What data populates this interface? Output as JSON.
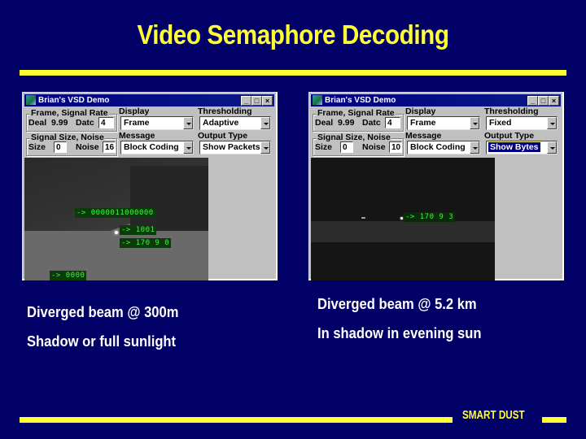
{
  "slide": {
    "title": "Video Semaphore Decoding",
    "footer_brand": "SMART DUST",
    "colors": {
      "background": "#000066",
      "accent": "#ffff33",
      "caption": "#ffffff",
      "overlay_text": "#33ff33"
    }
  },
  "windows": [
    {
      "title": "Brian's VSD Demo",
      "controls": {
        "minimize": "_",
        "maximize": "□",
        "close": "×"
      },
      "frame_group": {
        "label": "Frame, Signal Rate",
        "rate_label": "Deal",
        "rate_value": "9.99",
        "data_label": "Datc",
        "data_value": "4"
      },
      "signal_group": {
        "label": "Signal Size, Noise",
        "size_label": "Size",
        "size_value": "0",
        "noise_label": "Noise",
        "noise_value": "16"
      },
      "display": {
        "label": "Display",
        "value": "Frame"
      },
      "message": {
        "label": "Message",
        "value": "Block Coding"
      },
      "thresholding": {
        "label": "Thresholding",
        "value": "Adaptive"
      },
      "output_type": {
        "label": "Output Type",
        "value": "Show Packets"
      },
      "overlays": [
        "-> 0000011000000",
        "-> 1001",
        "-> 170 9 0",
        "-> 0000"
      ]
    },
    {
      "title": "Brian's VSD Demo",
      "controls": {
        "minimize": "_",
        "maximize": "□",
        "close": "×"
      },
      "frame_group": {
        "label": "Frame, Signal Rate",
        "rate_label": "Deal",
        "rate_value": "9.99",
        "data_label": "Datc",
        "data_value": "4"
      },
      "signal_group": {
        "label": "Signal Size, Noise",
        "size_label": "Size",
        "size_value": "0",
        "noise_label": "Noise",
        "noise_value": "10"
      },
      "display": {
        "label": "Display",
        "value": "Frame"
      },
      "message": {
        "label": "Message",
        "value": "Block Coding"
      },
      "thresholding": {
        "label": "Thresholding",
        "value": "Fixed"
      },
      "output_type": {
        "label": "Output Type",
        "value": "Show Bytes"
      },
      "overlays": [
        "-> 170 9 3"
      ]
    }
  ],
  "captions": {
    "left": [
      "Diverged beam @ 300m",
      "Shadow or full sunlight"
    ],
    "right": [
      "Diverged beam @ 5.2 km",
      "In shadow in evening sun"
    ]
  }
}
